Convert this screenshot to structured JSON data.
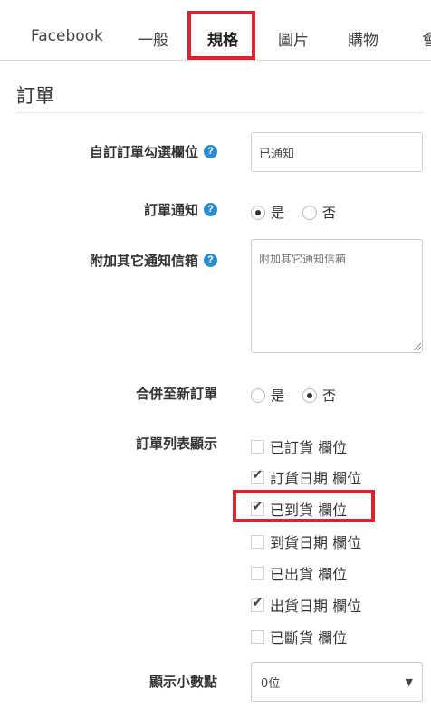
{
  "tabs": [
    {
      "label": "Facebook"
    },
    {
      "label": "一般"
    },
    {
      "label": "規格"
    },
    {
      "label": "圖片"
    },
    {
      "label": "購物"
    },
    {
      "label": "會"
    }
  ],
  "active_tab": "規格",
  "section": {
    "title": "訂單"
  },
  "fields": {
    "custom_check": {
      "label": "自訂訂單勾選欄位",
      "value": "已通知"
    },
    "order_notify": {
      "label": "訂單通知",
      "yes": "是",
      "no": "否",
      "selected": "是"
    },
    "extra_emails": {
      "label": "附加其它通知信箱",
      "placeholder": "附加其它通知信箱"
    },
    "merge_order": {
      "label": "合併至新訂單",
      "yes": "是",
      "no": "否",
      "selected": "否"
    },
    "list_display": {
      "label": "訂單列表顯示",
      "options": [
        {
          "label": "已訂貨 欄位",
          "checked": false
        },
        {
          "label": "訂貨日期 欄位",
          "checked": true
        },
        {
          "label": "已到貨 欄位",
          "checked": true
        },
        {
          "label": "到貨日期 欄位",
          "checked": false
        },
        {
          "label": "已出貨 欄位",
          "checked": false
        },
        {
          "label": "出貨日期 欄位",
          "checked": true
        },
        {
          "label": "已斷貨 欄位",
          "checked": false
        }
      ]
    },
    "decimals": {
      "label": "顯示小數點",
      "value": "0位"
    }
  },
  "icons": {
    "help": "help-icon",
    "check": "check-icon",
    "caret": "caret-down-icon"
  },
  "colors": {
    "highlight": "#d9242f",
    "help_icon": "#2b8fcf"
  }
}
